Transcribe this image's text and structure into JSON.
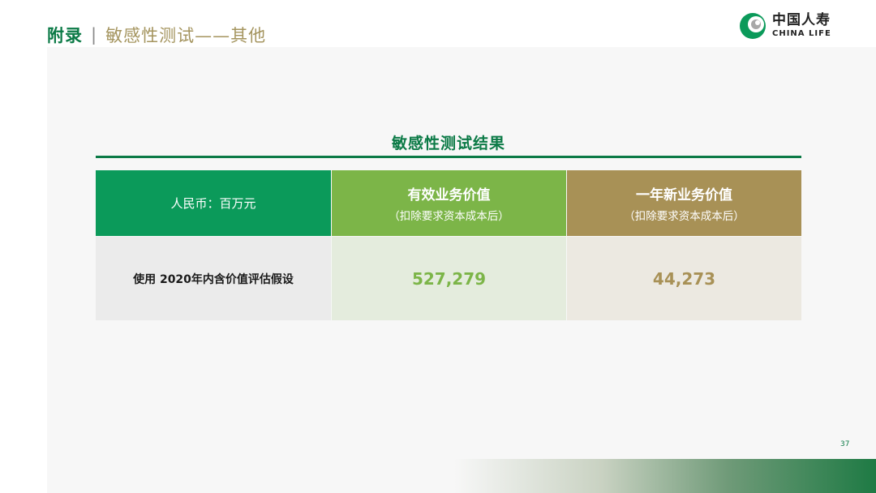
{
  "header": {
    "title_main": "附录",
    "title_sep": "|",
    "title_sub": "敏感性测试——其他"
  },
  "logo": {
    "name_cn": "中国人寿",
    "name_en": "CHINA LIFE"
  },
  "table": {
    "title": "敏感性测试结果",
    "unit_label": "人民币：百万元",
    "columns": [
      {
        "main": "有效业务价值",
        "sub": "（扣除要求资本成本后）"
      },
      {
        "main": "一年新业务价值",
        "sub": "（扣除要求资本成本后）"
      }
    ],
    "rows": [
      {
        "label": "使用 2020年内含价值评估假设",
        "values": [
          "527,279",
          "44,273"
        ]
      }
    ]
  },
  "page_number": "37",
  "colors": {
    "brand_green": "#0b7a46",
    "header_green": "#0b9a5a",
    "light_green": "#7cb548",
    "gold": "#a89156"
  }
}
